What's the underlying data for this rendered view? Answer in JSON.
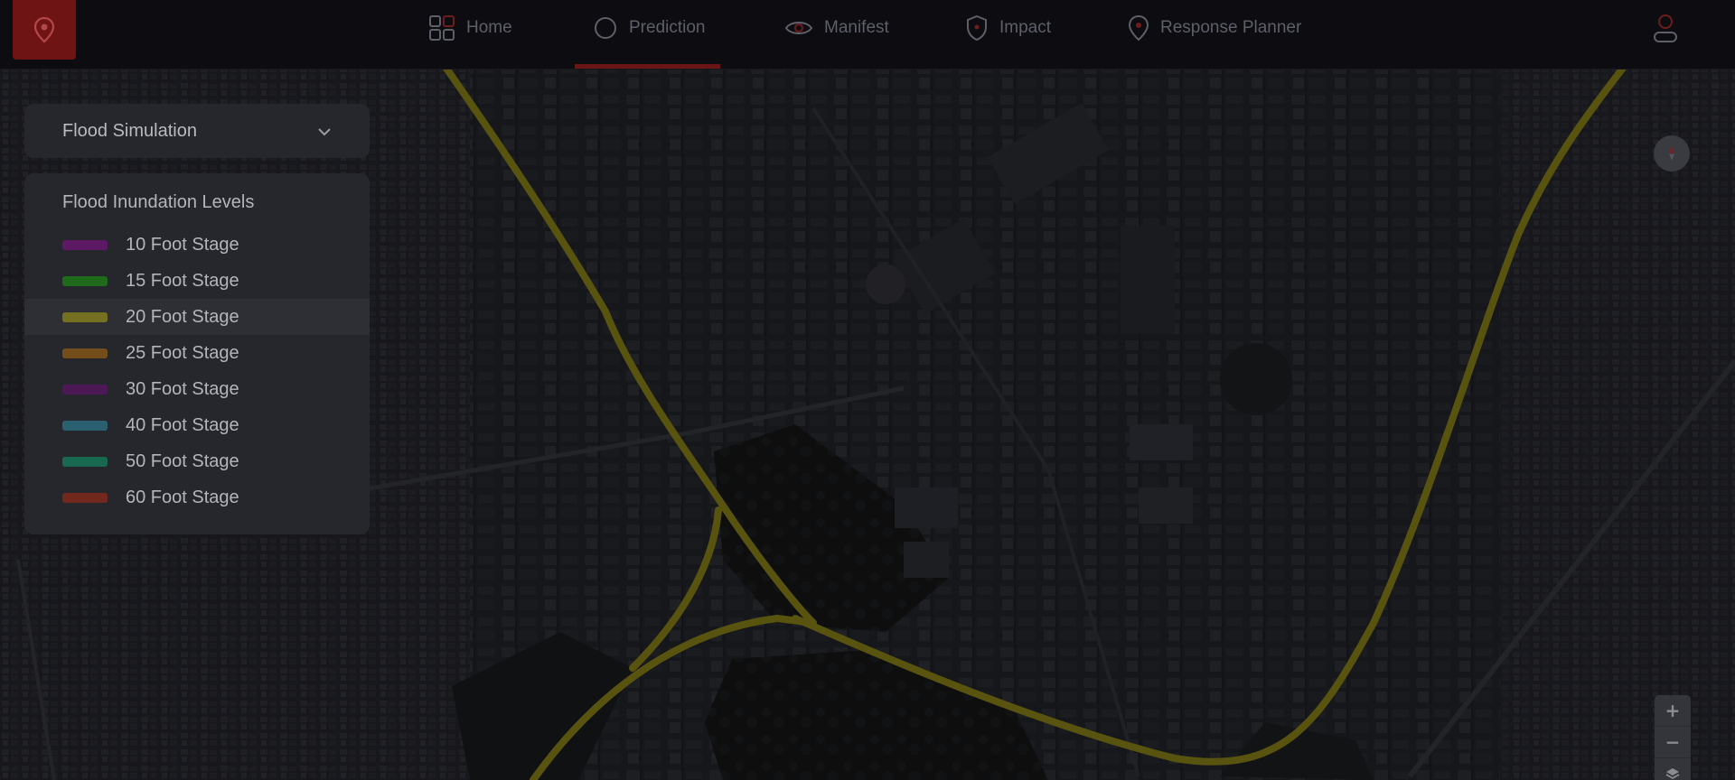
{
  "nav": {
    "items": [
      {
        "label": "Home",
        "icon": "grid-icon",
        "active": false
      },
      {
        "label": "Prediction",
        "icon": "circle-icon",
        "active": true
      },
      {
        "label": "Manifest",
        "icon": "eye-icon",
        "active": false
      },
      {
        "label": "Impact",
        "icon": "shield-icon",
        "active": false
      },
      {
        "label": "Response Planner",
        "icon": "map-pin-icon",
        "active": false
      }
    ],
    "accent_color": "#6a1616"
  },
  "simulation_select": {
    "value": "Flood Simulation",
    "icon": "chevron-down-icon"
  },
  "legend": {
    "title": "Flood Inundation Levels",
    "items": [
      {
        "label": "10 Foot Stage",
        "color": "#8a0f94"
      },
      {
        "label": "15 Foot Stage",
        "color": "#1aa30f"
      },
      {
        "label": "20 Foot Stage",
        "color": "#b0a814"
      },
      {
        "label": "25 Foot Stage",
        "color": "#b3700f"
      },
      {
        "label": "30 Foot Stage",
        "color": "#6b0f7a"
      },
      {
        "label": "40 Foot Stage",
        "color": "#2f8fab"
      },
      {
        "label": "50 Foot Stage",
        "color": "#0fa070"
      },
      {
        "label": "60 Foot Stage",
        "color": "#b32a14"
      }
    ],
    "highlighted_index": 2
  },
  "map": {
    "route_color": "#6b6410",
    "controls": {
      "zoom_in": "+",
      "zoom_out": "−"
    }
  }
}
